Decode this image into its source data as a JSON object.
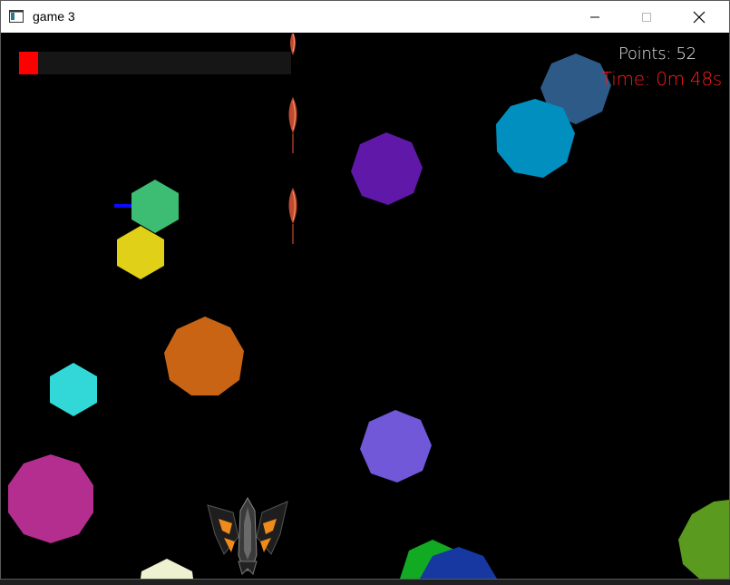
{
  "window": {
    "title": "game 3",
    "controls": {
      "minimize_icon": "minimize-icon",
      "maximize_icon": "maximize-icon",
      "close_icon": "close-icon"
    }
  },
  "hud": {
    "points_text": "Points: 52",
    "time_text": "Time: 0m 48s",
    "points_color": "#e9e9e9",
    "time_color": "#ff1a1a",
    "health_bar": {
      "fill_fraction": 0.07,
      "fill_color": "#ff0000",
      "track_color": "#161616"
    }
  },
  "colors": {
    "background": "#000000",
    "asteroids": [
      "#2d5a86",
      "#008fbf",
      "#6018a8",
      "#3dbd74",
      "#e0d018",
      "#c96415",
      "#32d8d8",
      "#7058d8",
      "#b42e90",
      "#5a9a1e",
      "#11aa22",
      "#1638a0",
      "#eef2d0"
    ],
    "player_ship": "#f08a1a",
    "missile": "#e06040",
    "enemy_laser": "#0a0aff"
  }
}
